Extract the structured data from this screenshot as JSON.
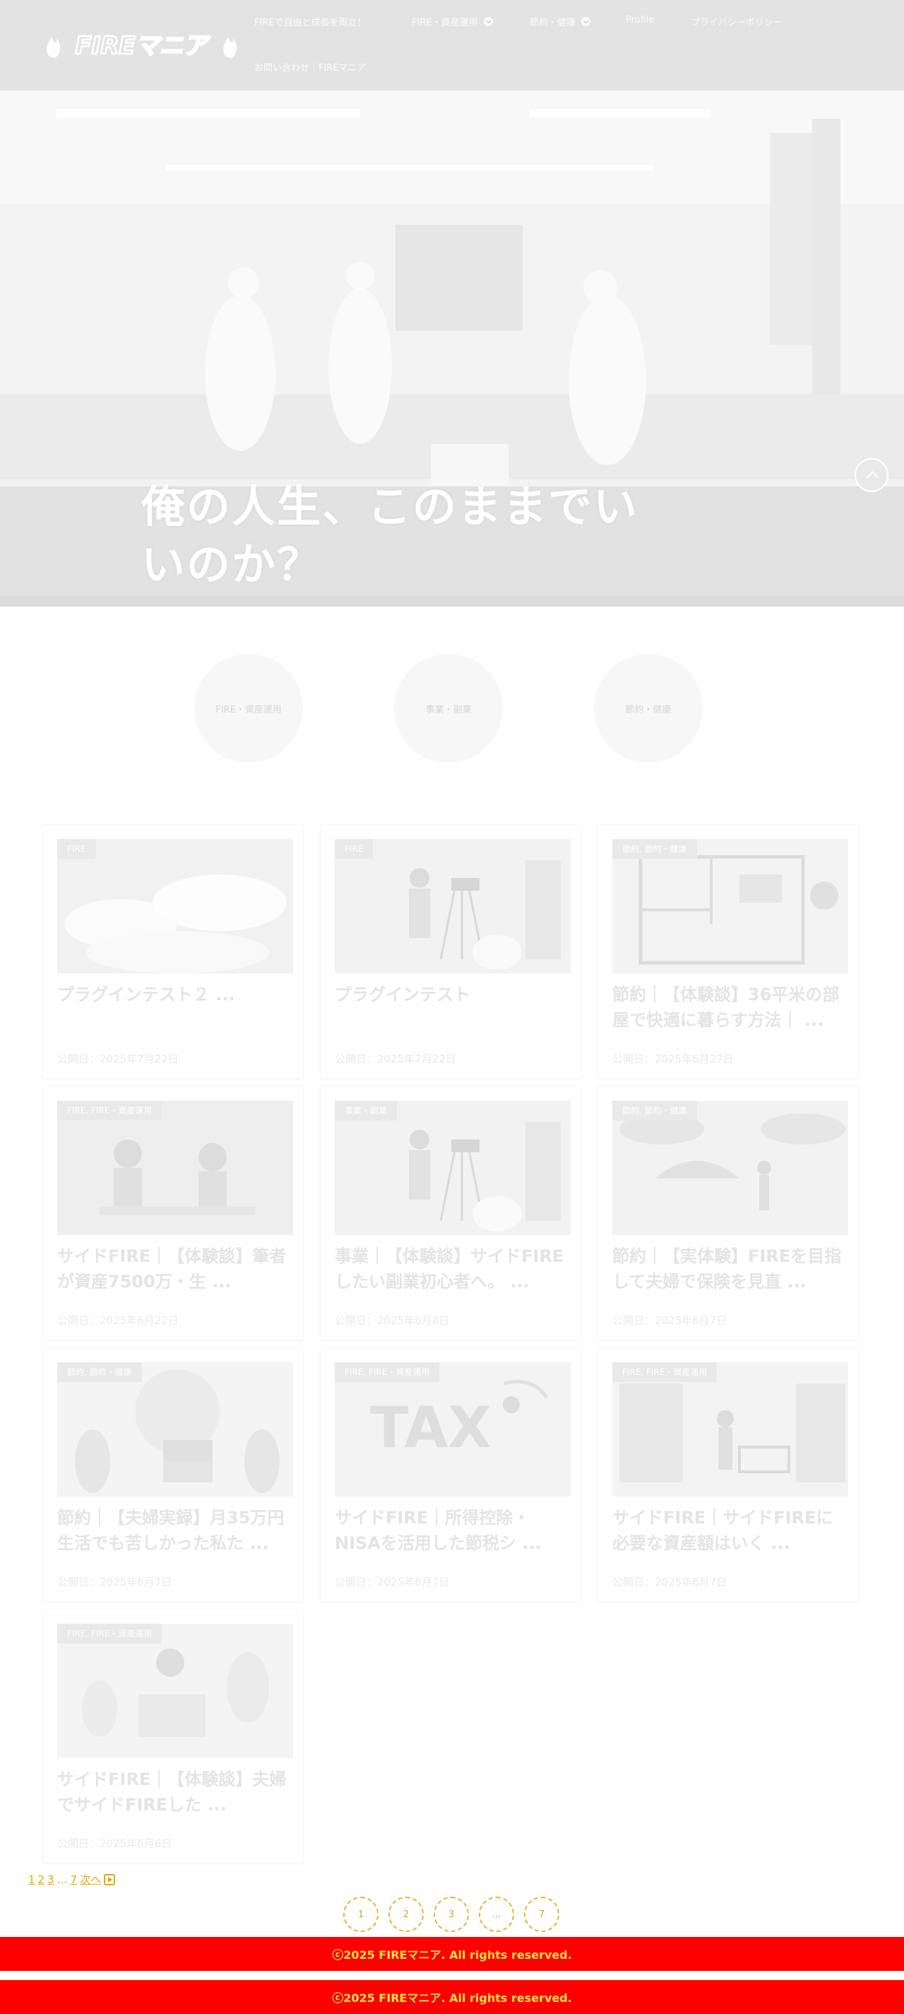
{
  "header": {
    "logo_text": "FIREマニア",
    "nav": [
      {
        "label": "FIREで自由と成長を両立！"
      },
      {
        "label": "FIRE・資産運用",
        "has_dropdown": true
      },
      {
        "label": "節約・健康",
        "has_dropdown": true
      },
      {
        "label": "Profile"
      },
      {
        "label": "プライバシーポリシー"
      },
      {
        "label": "お問い合わせ｜FIREマニア"
      }
    ]
  },
  "hero": {
    "title": "俺の人生、このままでいいのか？"
  },
  "categories": [
    {
      "label": "FIRE・資産運用"
    },
    {
      "label": "事業・副業"
    },
    {
      "label": "節約・健康"
    }
  ],
  "posts": [
    {
      "tag": "FIRE",
      "title": "プラグインテスト２ ...",
      "date": "公開日：2025年7月22日",
      "image": "sky-clouds"
    },
    {
      "tag": "FIRE",
      "title": "プラグインテスト",
      "date": "公開日：2025年7月22日",
      "image": "camera-man"
    },
    {
      "tag": "節約, 節約・健康",
      "title": "節約｜【体験談】36平米の部屋で快適に暮らす方法｜ ...",
      "date": "公開日：2025年6月27日",
      "image": "floor-plan"
    },
    {
      "tag": "FIRE, FIRE・資産運用",
      "title": "サイドFIRE｜【体験談】筆者が資産7500万・生 ...",
      "date": "公開日：2025年6月22日",
      "image": "couple-talk"
    },
    {
      "tag": "事業・副業",
      "title": "事業｜【体験談】サイドFIREしたい副業初心者へ。 ...",
      "date": "公開日：2025年6月8日",
      "image": "camera-man"
    },
    {
      "tag": "節約, 節約・健康",
      "title": "節約｜【実体験】FIREを目指して夫婦で保険を見直 ...",
      "date": "公開日：2025年6月7日",
      "image": "umbrella-rain"
    },
    {
      "tag": "節約, 節約・健康",
      "title": "節約｜【夫婦実録】月35万円生活でも苦しかった私た ...",
      "date": "公開日：2025年6月7日",
      "image": "boxes-plants"
    },
    {
      "tag": "FIRE, FIRE・資産運用",
      "title": "サイドFIRE｜所得控除・NISAを活用した節税シ ...",
      "date": "公開日：2025年6月7日",
      "image": "tax-letters"
    },
    {
      "tag": "FIRE, FIRE・資産運用",
      "title": "サイドFIRE｜サイドFIREに必要な資産額はいく ...",
      "date": "公開日：2025年6月7日",
      "image": "shopping-cart"
    },
    {
      "tag": "FIRE, FIRE・資産運用",
      "title": "サイドFIRE｜【体験談】夫婦でサイドFIREした ...",
      "date": "公開日：2025年6月6日",
      "image": "reading-man"
    }
  ],
  "pagination": {
    "text_links": [
      "1",
      "2",
      "3",
      "…",
      "7",
      "次へ"
    ],
    "circles": [
      "1",
      "2",
      "3",
      "…",
      "7"
    ]
  },
  "footer": {
    "copyright": "ⓒ2025 FIREマニア. All rights reserved."
  }
}
